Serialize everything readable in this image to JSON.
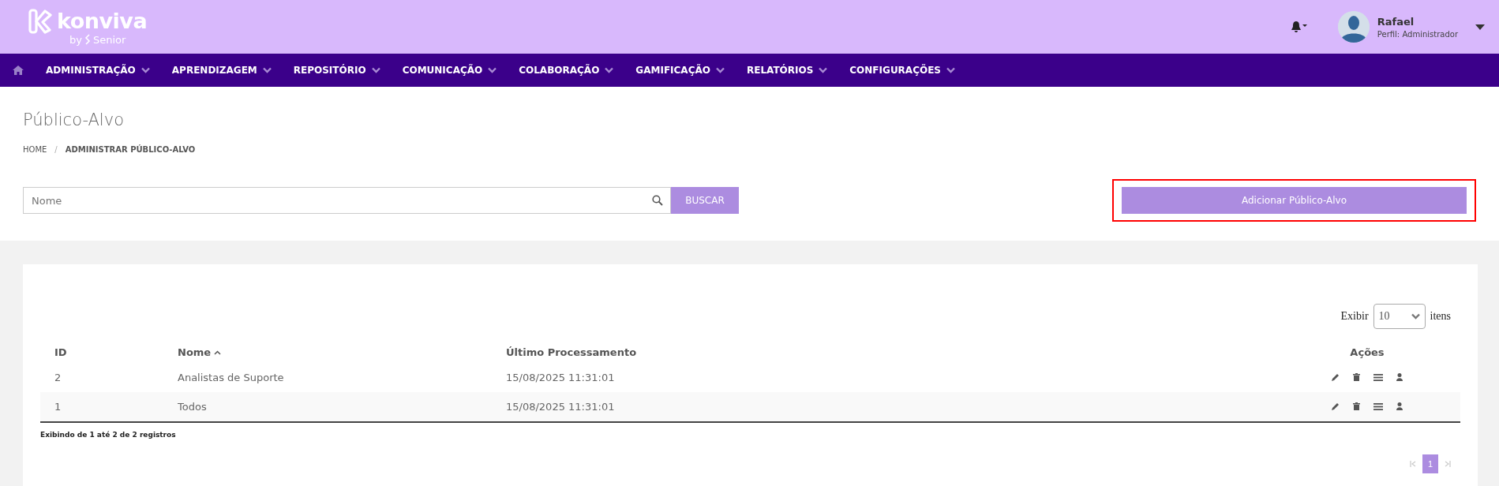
{
  "logo": {
    "name": "konviva",
    "by": "by",
    "brand": "Senior"
  },
  "user": {
    "name": "Rafael",
    "profile": "Perfil: Administrador"
  },
  "nav": [
    "ADMINISTRAÇÃO",
    "APRENDIZAGEM",
    "REPOSITÓRIO",
    "COMUNICAÇÃO",
    "COLABORAÇÃO",
    "GAMIFICAÇÃO",
    "RELATÓRIOS",
    "CONFIGURAÇÕES"
  ],
  "page_title": "Público-Alvo",
  "breadcrumb_separator": "/",
  "breadcrumb": [
    {
      "label": "HOME",
      "current": false
    },
    {
      "label": "ADMINISTRAR PÚBLICO-ALVO",
      "current": true
    }
  ],
  "search": {
    "placeholder": "Nome",
    "button": "BUSCAR"
  },
  "add_button": {
    "label": "Adicionar Público-Alvo",
    "highlighted": true
  },
  "page_size": {
    "label": "Exibir",
    "value": "10",
    "suffix": "itens"
  },
  "table": {
    "columns": [
      {
        "label": "ID",
        "sorted": false
      },
      {
        "label": "Nome",
        "sorted": true
      },
      {
        "label": "Último Processamento",
        "sorted": false
      },
      {
        "label": "Ações",
        "sorted": false
      }
    ],
    "rows": [
      {
        "id": "2",
        "name": "Analistas de Suporte",
        "processed": "15/08/2025 11:31:01"
      },
      {
        "id": "1",
        "name": "Todos",
        "processed": "15/08/2025 11:31:01"
      }
    ]
  },
  "summary": "Exibindo de 1 até 2 de 2 registros",
  "pagination": [
    {
      "label": "1",
      "selected": true
    }
  ]
}
